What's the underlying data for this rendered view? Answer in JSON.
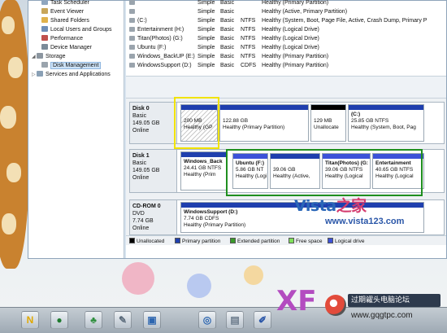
{
  "nav_tree": {
    "items": [
      {
        "label": "Task Scheduler",
        "indent": 2
      },
      {
        "label": "Event Viewer",
        "indent": 2
      },
      {
        "label": "Shared Folders",
        "indent": 2
      },
      {
        "label": "Local Users and Groups",
        "indent": 2
      },
      {
        "label": "Performance",
        "indent": 2
      },
      {
        "label": "Device Manager",
        "indent": 2
      },
      {
        "label": "Storage",
        "indent": 1
      },
      {
        "label": "Disk Management",
        "indent": 2,
        "selected": true
      },
      {
        "label": "Services and Applications",
        "indent": 1
      }
    ]
  },
  "volume_list": {
    "rows": [
      {
        "name": "",
        "layout": "Simple",
        "type": "Basic",
        "fs": "",
        "status": "Healthy (Primary Partition)"
      },
      {
        "name": "",
        "layout": "Simple",
        "type": "Basic",
        "fs": "",
        "status": "Healthy (Active, Primary Partition)"
      },
      {
        "name": "(C:)",
        "layout": "Simple",
        "type": "Basic",
        "fs": "NTFS",
        "status": "Healthy (System, Boot, Page File, Active, Crash Dump, Primary P"
      },
      {
        "name": "Entertainment (H:)",
        "layout": "Simple",
        "type": "Basic",
        "fs": "NTFS",
        "status": "Healthy (Logical Drive)"
      },
      {
        "name": "Titan(Photos) (G:)",
        "layout": "Simple",
        "type": "Basic",
        "fs": "NTFS",
        "status": "Healthy (Logical Drive)"
      },
      {
        "name": "Ubuntu (F:)",
        "layout": "Simple",
        "type": "Basic",
        "fs": "NTFS",
        "status": "Healthy (Logical Drive)"
      },
      {
        "name": "Windows_BackUP (E:)",
        "layout": "Simple",
        "type": "Basic",
        "fs": "NTFS",
        "status": "Healthy (Primary Partition)"
      },
      {
        "name": "WindowsSupport (D:)",
        "layout": "Simple",
        "type": "Basic",
        "fs": "CDFS",
        "status": "Healthy (Primary Partition)"
      }
    ]
  },
  "disks": {
    "disk0": {
      "name": "Disk 0",
      "type": "Basic",
      "size": "149.05 GB",
      "state": "Online",
      "partitions": [
        {
          "line1": "",
          "line2": "200 MB",
          "line3": "Healthy (GP"
        },
        {
          "line1": "",
          "line2": "122.88 GB",
          "line3": "Healthy (Primary Partition)"
        },
        {
          "line1": "",
          "line2": "129 MB",
          "line3": "Unallocate"
        },
        {
          "line1": "(C:)",
          "line2": "25.85 GB NTFS",
          "line3": "Healthy (System, Boot, Pag"
        }
      ]
    },
    "disk1": {
      "name": "Disk 1",
      "type": "Basic",
      "size": "149.05 GB",
      "state": "Online",
      "partitions": [
        {
          "line1": "Windows_Back",
          "line2": "24.41 GB NTFS",
          "line3": "Healthy (Prim"
        },
        {
          "line1": "Ubuntu  (F:)",
          "line2": "5.86 GB NT",
          "line3": "Healthy (Logi"
        },
        {
          "line1": "",
          "line2": "39.06 GB",
          "line3": "Healthy (Active,"
        },
        {
          "line1": "Titan(Photos)  (G:",
          "line2": "39.06 GB NTFS",
          "line3": "Healthy (Logical"
        },
        {
          "line1": "Entertainment",
          "line2": "40.65 GB NTFS",
          "line3": "Healthy (Logical"
        }
      ]
    },
    "cdrom0": {
      "name": "CD-ROM 0",
      "type": "DVD",
      "size": "7.74 GB",
      "state": "Online",
      "partitions": [
        {
          "line1": "WindowsSupport  (D:)",
          "line2": "7.74 GB CDFS",
          "line3": "Healthy (Primary Partition)"
        }
      ]
    }
  },
  "legend": {
    "items": [
      {
        "label": "Unallocated",
        "color": "#000000"
      },
      {
        "label": "Primary partition",
        "color": "#1f3fae"
      },
      {
        "label": "Extended partition",
        "color": "#3a9a2a"
      },
      {
        "label": "Free space",
        "color": "#7fe05a"
      },
      {
        "label": "Logical drive",
        "color": "#3c52d8"
      }
    ]
  },
  "colors": {
    "primary_bar": "#1f3fae",
    "logical_bar": "#3c52d8",
    "unallocated_bar": "#000000",
    "extended_border": "#1f8f1f",
    "highlight_yellow": "#f1e300"
  },
  "watermarks": {
    "vista_text": "Vista",
    "vista_suffix": "之家",
    "vista_url": "www.vista123.com",
    "xf_text": "XF",
    "badge_text": "过期糴头电脑论坛",
    "badge_url": "www.gqgtpc.com"
  },
  "taskbar": {
    "icons": [
      "start-n-icon",
      "media-icon",
      "network-icon",
      "pen-icon",
      "window-icon",
      "ie-icon",
      "shell-icon",
      "paint-icon"
    ]
  }
}
